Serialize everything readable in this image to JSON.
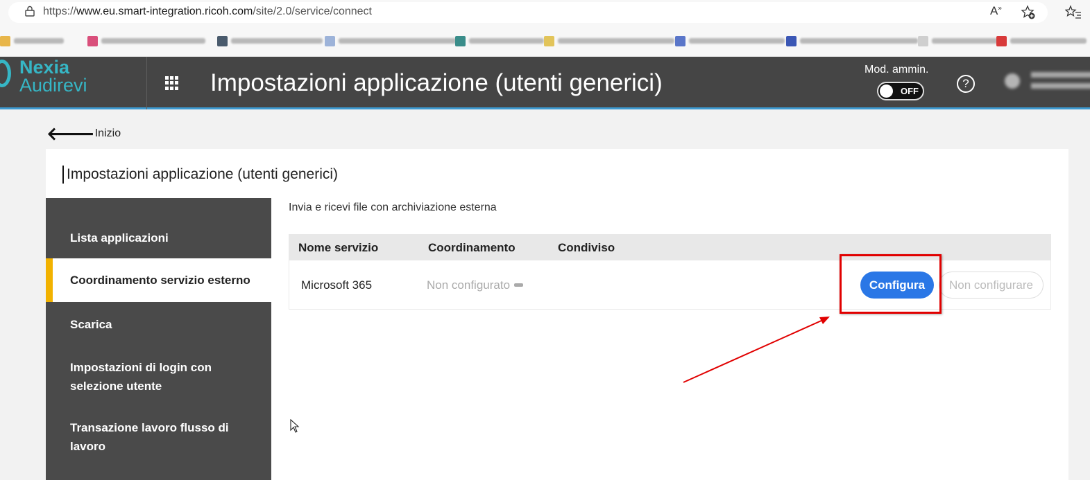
{
  "browser": {
    "url_prefix": "https://",
    "url_domain": "www.eu.smart-integration.ricoh.com",
    "url_path": "/site/2.0/service/connect",
    "icons": [
      "lock-icon",
      "read-aloud-icon",
      "add-favorite-icon",
      "favorites-icon"
    ]
  },
  "header": {
    "logo_line1": "Nexia",
    "logo_line2": "Audirevi",
    "title": "Impostazioni applicazione (utenti generici)",
    "admin_mode_label": "Mod. ammin.",
    "admin_toggle_state": "OFF",
    "help_symbol": "?"
  },
  "back_link": {
    "label": "Inizio"
  },
  "card": {
    "title": "Impostazioni applicazione (utenti generici)"
  },
  "sidebar": {
    "items": [
      {
        "line1": "Lista applicazioni",
        "line2": "",
        "active": false
      },
      {
        "line1": "Coordinamento servizio esterno",
        "line2": "",
        "active": true
      },
      {
        "line1": "Scarica",
        "line2": "",
        "active": false
      },
      {
        "line1": "Impostazioni di login con",
        "line2": "selezione utente",
        "active": false
      },
      {
        "line1": "Transazione lavoro flusso di",
        "line2": "lavoro",
        "active": false
      }
    ]
  },
  "main": {
    "subtitle": "Invia e ricevi file con archiviazione esterna",
    "table": {
      "headers": [
        "Nome servizio",
        "Coordinamento",
        "Condiviso"
      ],
      "rows": [
        {
          "service": "Microsoft 365",
          "status": "Non configurato",
          "configure_label": "Configura",
          "unconfigure_label": "Non configurare"
        }
      ]
    }
  },
  "colors": {
    "header_bg": "#454545",
    "accent_teal": "#36b6c5",
    "primary_button": "#2a77e6",
    "active_nav_marker": "#f2b200",
    "annotation_red": "#e10000"
  }
}
